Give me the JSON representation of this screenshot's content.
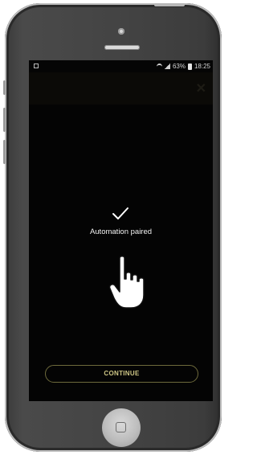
{
  "status_bar": {
    "battery_percent": "63%",
    "time": "18:25"
  },
  "dialog": {
    "message": "Automation paired",
    "continue_label": "CONTINUE"
  },
  "icons": {
    "status_left": "image-notification-icon",
    "wifi": "wifi-icon",
    "signal": "signal-icon",
    "battery": "battery-icon",
    "close": "close-icon",
    "check": "checkmark-icon",
    "hand": "tap-hand-icon",
    "home": "home-button-icon"
  },
  "colors": {
    "screen_background": "#040404",
    "button_border": "#6e6a3c",
    "button_text": "#cfc786",
    "message_text": "#f2f2f2"
  }
}
